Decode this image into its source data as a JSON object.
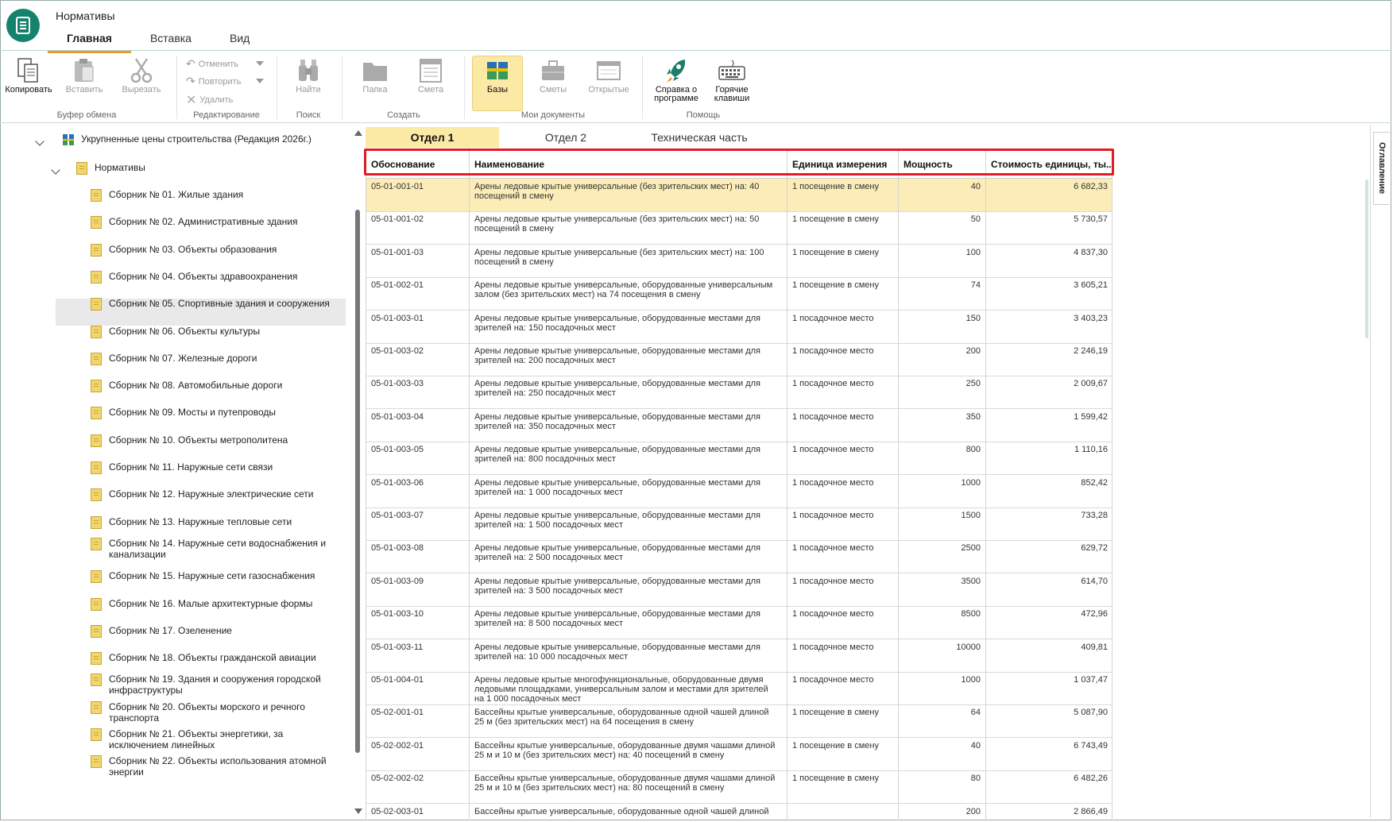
{
  "app": {
    "title": "Нормативы",
    "tabs": [
      "Главная",
      "Вставка",
      "Вид"
    ],
    "active_tab": 0
  },
  "ribbon": {
    "copy": "Копировать",
    "paste": "Вставить",
    "cut": "Вырезать",
    "undo": "Отменить",
    "redo": "Повторить",
    "delete": "Удалить",
    "find": "Найти",
    "folder": "Папка",
    "estimate": "Смета",
    "bases": "Базы",
    "estimates": "Сметы",
    "opened": "Открытые",
    "about_l1": "Справка о",
    "about_l2": "программе",
    "hotkeys_l1": "Горячие",
    "hotkeys_l2": "клавиши",
    "groups": {
      "clipboard": "Буфер обмена",
      "editing": "Редактирование",
      "search": "Поиск",
      "create": "Создать",
      "my_docs": "Мои документы",
      "help": "Помощь"
    }
  },
  "tree": {
    "root": "Укрупненные цены строительства (Редакция 2026г.)",
    "node": "Нормативы",
    "items": [
      [
        "Сборник № 01. Жилые здания"
      ],
      [
        "Сборник № 02. Административные здания"
      ],
      [
        "Сборник № 03. Объекты образования"
      ],
      [
        "Сборник № 04. Объекты здравоохранения"
      ],
      [
        "Сборник № 05. Спортивные здания и сооружения"
      ],
      [
        "Сборник № 06. Объекты культуры"
      ],
      [
        "Сборник № 07. Железные дороги"
      ],
      [
        "Сборник № 08. Автомобильные дороги"
      ],
      [
        "Сборник № 09. Мосты и путепроводы"
      ],
      [
        "Сборник № 10. Объекты метрополитена"
      ],
      [
        "Сборник № 11. Наружные сети связи"
      ],
      [
        "Сборник № 12. Наружные электрические сети"
      ],
      [
        "Сборник № 13. Наружные тепловые сети"
      ],
      [
        "Сборник № 14. Наружные сети водоснабжения и",
        "канализации"
      ],
      [
        "Сборник № 15. Наружные сети газоснабжения"
      ],
      [
        "Сборник № 16. Малые архитектурные формы"
      ],
      [
        "Сборник № 17. Озеленение"
      ],
      [
        "Сборник № 18. Объекты гражданской авиации"
      ],
      [
        "Сборник № 19. Здания и сооружения городской",
        "инфраструктуры"
      ],
      [
        "Сборник № 20. Объекты морского и речного",
        "транспорта"
      ],
      [
        "Сборник № 21. Объекты энергетики, за",
        "исключением линейных"
      ],
      [
        "Сборник № 22. Объекты использования атомной",
        "энергии"
      ]
    ],
    "selected_index": 4
  },
  "doc_tabs": [
    "Отдел 1",
    "Отдел 2",
    "Техническая часть"
  ],
  "table": {
    "columns": [
      "Обоснование",
      "Наименование",
      "Единица измерения",
      "Мощность",
      "Стоимость единицы, ты..."
    ],
    "rows": [
      [
        "05-01-001-01",
        [
          "Арены ледовые крытые универсальные (без зрительских мест) на: 40",
          "посещений в смену"
        ],
        "1 посещение в смену",
        "40",
        "6 682,33"
      ],
      [
        "05-01-001-02",
        [
          "Арены ледовые крытые универсальные (без зрительских мест) на: 50",
          "посещений в смену"
        ],
        "1 посещение в смену",
        "50",
        "5 730,57"
      ],
      [
        "05-01-001-03",
        [
          "Арены ледовые крытые универсальные (без зрительских мест) на: 100",
          "посещений в смену"
        ],
        "1 посещение в смену",
        "100",
        "4 837,30"
      ],
      [
        "05-01-002-01",
        [
          "Арены ледовые крытые универсальные, оборудованные универсальным",
          "залом (без зрительских мест) на 74 посещения в смену"
        ],
        "1 посещение в смену",
        "74",
        "3 605,21"
      ],
      [
        "05-01-003-01",
        [
          "Арены ледовые крытые универсальные, оборудованные местами для",
          "зрителей на: 150 посадочных мест"
        ],
        "1 посадочное место",
        "150",
        "3 403,23"
      ],
      [
        "05-01-003-02",
        [
          "Арены ледовые крытые универсальные, оборудованные местами для",
          "зрителей на: 200 посадочных мест"
        ],
        "1 посадочное место",
        "200",
        "2 246,19"
      ],
      [
        "05-01-003-03",
        [
          "Арены ледовые крытые универсальные, оборудованные местами для",
          "зрителей на: 250 посадочных мест"
        ],
        "1 посадочное место",
        "250",
        "2 009,67"
      ],
      [
        "05-01-003-04",
        [
          "Арены ледовые крытые универсальные, оборудованные местами для",
          "зрителей на: 350 посадочных мест"
        ],
        "1 посадочное место",
        "350",
        "1 599,42"
      ],
      [
        "05-01-003-05",
        [
          "Арены ледовые крытые универсальные, оборудованные местами для",
          "зрителей на: 800 посадочных мест"
        ],
        "1 посадочное место",
        "800",
        "1 110,16"
      ],
      [
        "05-01-003-06",
        [
          "Арены ледовые крытые универсальные, оборудованные местами для",
          "зрителей на: 1 000 посадочных мест"
        ],
        "1 посадочное место",
        "1000",
        "852,42"
      ],
      [
        "05-01-003-07",
        [
          "Арены ледовые крытые универсальные, оборудованные местами для",
          "зрителей на: 1 500 посадочных мест"
        ],
        "1 посадочное место",
        "1500",
        "733,28"
      ],
      [
        "05-01-003-08",
        [
          "Арены ледовые крытые универсальные, оборудованные местами для",
          "зрителей на: 2 500 посадочных мест"
        ],
        "1 посадочное место",
        "2500",
        "629,72"
      ],
      [
        "05-01-003-09",
        [
          "Арены ледовые крытые универсальные, оборудованные местами для",
          "зрителей на: 3 500 посадочных мест"
        ],
        "1 посадочное место",
        "3500",
        "614,70"
      ],
      [
        "05-01-003-10",
        [
          "Арены ледовые крытые универсальные, оборудованные местами для",
          "зрителей на: 8 500 посадочных мест"
        ],
        "1 посадочное место",
        "8500",
        "472,96"
      ],
      [
        "05-01-003-11",
        [
          "Арены ледовые крытые универсальные, оборудованные местами для",
          "зрителей на: 10 000 посадочных мест"
        ],
        "1 посадочное место",
        "10000",
        "409,81"
      ],
      [
        "05-01-004-01",
        [
          "Арены ледовые крытые многофункциональные, оборудованные двумя",
          "ледовыми площадками, универсальным залом и местами для зрителей",
          "на 1 000 посадочных мест"
        ],
        "1 посадочное место",
        "1000",
        "1 037,47"
      ],
      [
        "05-02-001-01",
        [
          "Бассейны крытые универсальные, оборудованные одной чашей длиной",
          "25 м (без зрительских мест) на 64 посещения в смену"
        ],
        "1 посещение в смену",
        "64",
        "5 087,90"
      ],
      [
        "05-02-002-01",
        [
          "Бассейны крытые универсальные, оборудованные двумя чашами длиной",
          "25 м и 10 м (без зрительских мест) на: 40 посещений в смену"
        ],
        "1 посещение в смену",
        "40",
        "6 743,49"
      ],
      [
        "05-02-002-02",
        [
          "Бассейны крытые универсальные, оборудованные двумя чашами длиной",
          "25 м и 10 м (без зрительских мест) на: 80 посещений в смену"
        ],
        "1 посещение в смену",
        "80",
        "6 482,26"
      ],
      [
        "05-02-003-01",
        [
          "Бассейны крытые универсальные, оборудованные одной чашей длиной",
          ""
        ],
        "",
        "200",
        "2 866,49"
      ]
    ],
    "selected_index": 0
  },
  "side_panel": {
    "label": "Оглавление"
  },
  "colors": {
    "accent": "#15836c",
    "tab_underline": "#e89a2c",
    "selection": "#fcedb8",
    "highlight_border": "#e31b23"
  }
}
